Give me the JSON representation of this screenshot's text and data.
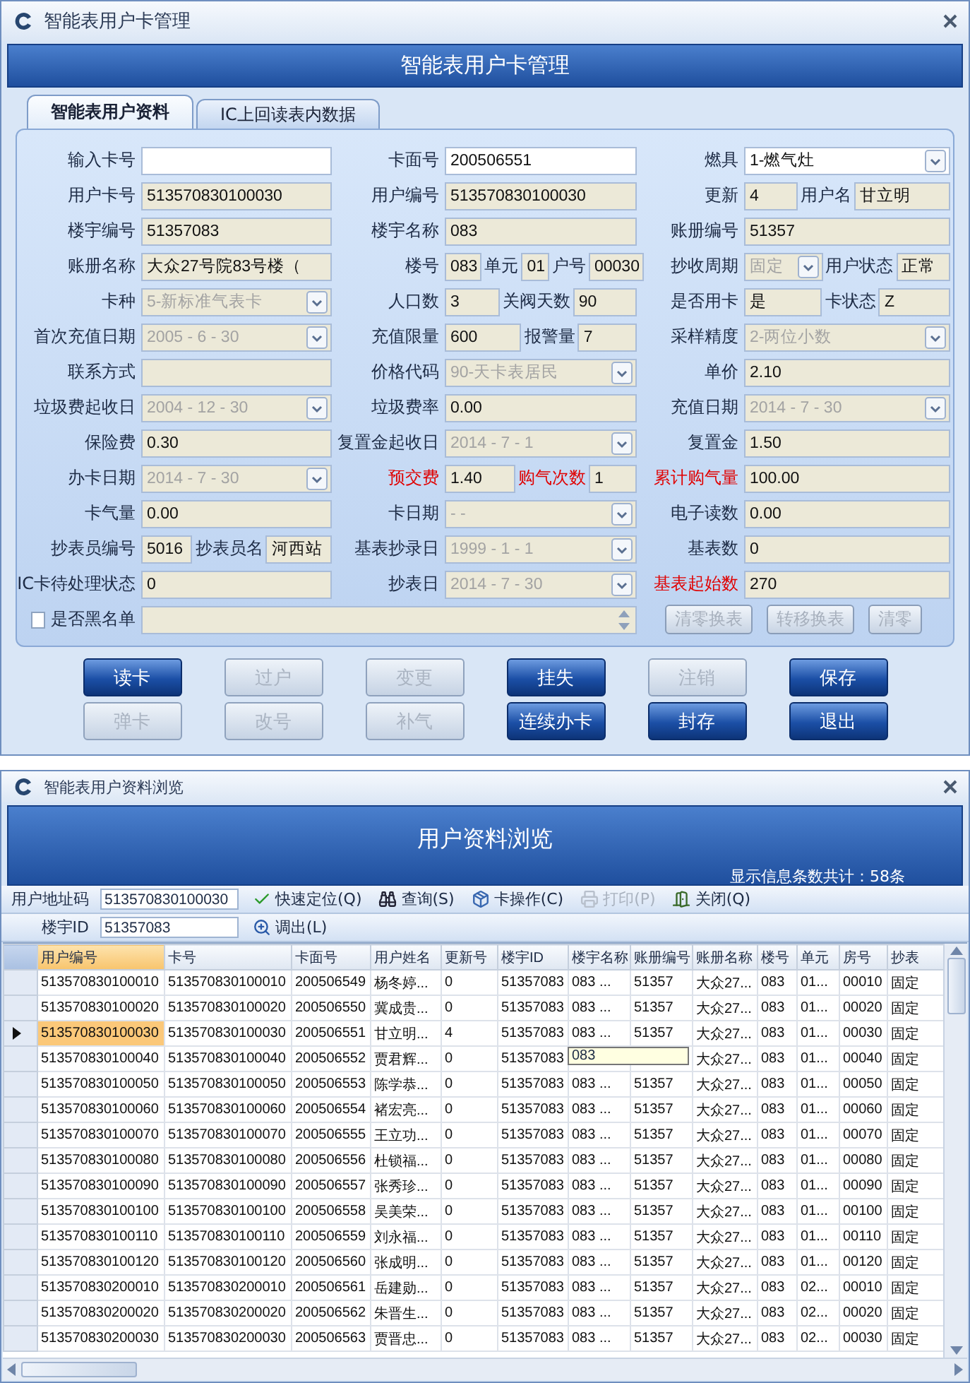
{
  "main_window": {
    "title": "智能表用户卡管理",
    "header": "智能表用户卡管理",
    "tabs": [
      {
        "label": "智能表用户资料",
        "selected": true
      },
      {
        "label": "IC上回读表内数据",
        "selected": false
      }
    ],
    "form_rows": [
      {
        "kind": "fields",
        "cells": [
          {
            "label": "输入卡号",
            "fields": [
              {
                "kind": "input"
              }
            ]
          },
          {
            "label": "卡面号",
            "fields": [
              {
                "kind": "input",
                "value": "200506551"
              }
            ]
          },
          {
            "label": "燃具",
            "fields": [
              {
                "kind": "select",
                "value": "1-燃气灶",
                "enabled": true
              }
            ]
          }
        ]
      },
      {
        "kind": "fields",
        "cells": [
          {
            "label": "用户卡号",
            "fields": [
              {
                "kind": "readonly",
                "value": "513570830100030"
              }
            ]
          },
          {
            "label": "用户编号",
            "fields": [
              {
                "kind": "readonly",
                "value": "513570830100030"
              }
            ]
          },
          {
            "label": "更新",
            "fields": [
              {
                "kind": "readonly",
                "value": "4"
              },
              {
                "kind": "caption",
                "text": "用户名"
              },
              {
                "kind": "readonly",
                "value": "甘立明"
              }
            ]
          }
        ]
      },
      {
        "kind": "fields",
        "cells": [
          {
            "label": "楼宇编号",
            "fields": [
              {
                "kind": "readonly",
                "value": "51357083"
              }
            ]
          },
          {
            "label": "楼宇名称",
            "fields": [
              {
                "kind": "readonly",
                "value": "083"
              }
            ]
          },
          {
            "label": "账册编号",
            "fields": [
              {
                "kind": "readonly",
                "value": "51357"
              }
            ]
          }
        ]
      },
      {
        "kind": "fields",
        "cells": [
          {
            "label": "账册名称",
            "fields": [
              {
                "kind": "readonly",
                "value": "大众27号院83号楼（"
              }
            ]
          },
          {
            "label": "楼号",
            "fields": [
              {
                "kind": "readonly",
                "value": "083"
              },
              {
                "kind": "caption",
                "text": "单元"
              },
              {
                "kind": "readonly",
                "value": "01"
              },
              {
                "kind": "caption",
                "text": "户号"
              },
              {
                "kind": "readonly",
                "value": "00030"
              }
            ]
          },
          {
            "label": "抄收周期",
            "fields": [
              {
                "kind": "select",
                "value": "固定",
                "enabled": false
              },
              {
                "kind": "caption",
                "text": "用户状态"
              },
              {
                "kind": "readonly",
                "value": "正常"
              }
            ]
          }
        ]
      },
      {
        "kind": "fields",
        "cells": [
          {
            "label": "卡种",
            "fields": [
              {
                "kind": "select",
                "value": "5-新标准气表卡",
                "enabled": false
              }
            ]
          },
          {
            "label": "人口数",
            "fields": [
              {
                "kind": "readonly",
                "value": "3"
              },
              {
                "kind": "caption",
                "text": "关阀天数"
              },
              {
                "kind": "readonly",
                "value": "90"
              }
            ]
          },
          {
            "label": "是否用卡",
            "fields": [
              {
                "kind": "readonly",
                "value": "是"
              },
              {
                "kind": "caption",
                "text": "卡状态"
              },
              {
                "kind": "readonly",
                "value": "Z"
              }
            ]
          }
        ]
      },
      {
        "kind": "fields",
        "cells": [
          {
            "label": "首次充值日期",
            "fields": [
              {
                "kind": "select",
                "value": "2005 - 6 - 30",
                "enabled": false
              }
            ]
          },
          {
            "label": "充值限量",
            "fields": [
              {
                "kind": "readonly",
                "value": "600"
              },
              {
                "kind": "caption",
                "text": "报警量"
              },
              {
                "kind": "readonly",
                "value": "7"
              }
            ]
          },
          {
            "label": "采样精度",
            "fields": [
              {
                "kind": "select",
                "value": "2-两位小数",
                "enabled": false
              }
            ]
          }
        ]
      },
      {
        "kind": "fields",
        "cells": [
          {
            "label": "联系方式",
            "fields": [
              {
                "kind": "readonly"
              }
            ]
          },
          {
            "label": "价格代码",
            "fields": [
              {
                "kind": "select",
                "value": "90-天卡表居民",
                "enabled": false
              }
            ]
          },
          {
            "label": "单价",
            "fields": [
              {
                "kind": "readonly",
                "value": "2.10"
              }
            ]
          }
        ]
      },
      {
        "kind": "fields",
        "cells": [
          {
            "label": "垃圾费起收日",
            "fields": [
              {
                "kind": "select",
                "value": "2004 - 12 - 30",
                "enabled": false
              }
            ]
          },
          {
            "label": "垃圾费率",
            "fields": [
              {
                "kind": "readonly",
                "value": "0.00"
              }
            ]
          },
          {
            "label": "充值日期",
            "fields": [
              {
                "kind": "select",
                "value": "2014 - 7 - 30",
                "enabled": false
              }
            ]
          }
        ]
      },
      {
        "kind": "fields",
        "cells": [
          {
            "label": "保险费",
            "fields": [
              {
                "kind": "readonly",
                "value": "0.30"
              }
            ]
          },
          {
            "label": "复置金起收日",
            "fields": [
              {
                "kind": "select",
                "value": "2014 - 7 - 1",
                "enabled": false
              }
            ]
          },
          {
            "label": "复置金",
            "fields": [
              {
                "kind": "readonly",
                "value": "1.50"
              }
            ]
          }
        ]
      },
      {
        "kind": "fields",
        "cells": [
          {
            "label": "办卡日期",
            "fields": [
              {
                "kind": "select",
                "value": "2014 - 7 - 30",
                "enabled": false
              }
            ]
          },
          {
            "label": "预交费",
            "alert": true,
            "fields": [
              {
                "kind": "readonly",
                "value": "1.40"
              },
              {
                "kind": "caption",
                "text": "购气次数",
                "alert": true
              },
              {
                "kind": "readonly",
                "value": "1"
              }
            ]
          },
          {
            "label": "累计购气量",
            "alert": true,
            "fields": [
              {
                "kind": "readonly",
                "value": "100.00"
              }
            ]
          }
        ]
      },
      {
        "kind": "fields",
        "cells": [
          {
            "label": "卡气量",
            "fields": [
              {
                "kind": "readonly",
                "value": "0.00"
              }
            ]
          },
          {
            "label": "卡日期",
            "fields": [
              {
                "kind": "select",
                "value": "-   -",
                "enabled": false
              }
            ]
          },
          {
            "label": "电子读数",
            "fields": [
              {
                "kind": "readonly",
                "value": "0.00"
              }
            ]
          }
        ]
      },
      {
        "kind": "fields",
        "cells": [
          {
            "label": "抄表员编号",
            "fields": [
              {
                "kind": "readonly",
                "value": "5016"
              },
              {
                "kind": "caption",
                "text": "抄表员名"
              },
              {
                "kind": "readonly",
                "value": "河西站"
              }
            ]
          },
          {
            "label": "基表抄录日",
            "fields": [
              {
                "kind": "select",
                "value": "1999 - 1 - 1",
                "enabled": false
              }
            ]
          },
          {
            "label": "基表数",
            "fields": [
              {
                "kind": "readonly",
                "value": "0"
              }
            ]
          }
        ]
      },
      {
        "kind": "fields",
        "cells": [
          {
            "label": "IC卡待处理状态",
            "fields": [
              {
                "kind": "readonly",
                "value": "0"
              }
            ]
          },
          {
            "label": "抄表日",
            "fields": [
              {
                "kind": "select",
                "value": "2014 - 7 - 30",
                "enabled": false
              }
            ]
          },
          {
            "label": "基表起始数",
            "alert": true,
            "fields": [
              {
                "kind": "readonly",
                "value": "270"
              }
            ]
          }
        ]
      },
      {
        "kind": "blacklist",
        "label": "是否黑名单",
        "checked": false,
        "actions": [
          {
            "label": "清零换表",
            "enabled": false
          },
          {
            "label": "转移换表",
            "enabled": false
          },
          {
            "label": "清零",
            "enabled": false
          }
        ]
      }
    ],
    "button_rows": [
      [
        {
          "label": "读卡",
          "enabled": true
        },
        {
          "label": "过户",
          "enabled": false
        },
        {
          "label": "变更",
          "enabled": false
        },
        {
          "label": "挂失",
          "enabled": true
        },
        {
          "label": "注销",
          "enabled": false
        },
        {
          "label": "保存",
          "enabled": true
        }
      ],
      [
        {
          "label": "弹卡",
          "enabled": false
        },
        {
          "label": "改号",
          "enabled": false
        },
        {
          "label": "补气",
          "enabled": false
        },
        {
          "label": "连续办卡",
          "enabled": true
        },
        {
          "label": "封存",
          "enabled": true
        },
        {
          "label": "退出",
          "enabled": true
        }
      ]
    ]
  },
  "browse_window": {
    "title": "智能表用户资料浏览",
    "header": "用户资料浏览",
    "count": "显示信息条数共计：58条",
    "toolbars": [
      [
        {
          "kind": "label",
          "text": "用户地址码"
        },
        {
          "kind": "input",
          "value": "513570830100030"
        },
        {
          "kind": "button",
          "label": "快速定位(Q)",
          "enabled": true
        },
        {
          "kind": "button",
          "label": "查询(S)",
          "enabled": true
        },
        {
          "kind": "button",
          "label": "卡操作(C)",
          "enabled": true
        },
        {
          "kind": "button",
          "label": "打印(P)",
          "enabled": false
        },
        {
          "kind": "button",
          "label": "关闭(Q)",
          "enabled": true
        }
      ],
      [
        {
          "kind": "label",
          "text": "楼宇ID"
        },
        {
          "kind": "input",
          "value": "51357083"
        },
        {
          "kind": "button",
          "label": "调出(L)",
          "enabled": true
        }
      ]
    ],
    "table": {
      "columns": [
        {
          "label": "用户编号",
          "selected": true
        },
        {
          "label": "卡号",
          "selected": false
        },
        {
          "label": "卡面号",
          "selected": false
        },
        {
          "label": "用户姓名",
          "selected": false
        },
        {
          "label": "更新号",
          "selected": false
        },
        {
          "label": "楼宇ID",
          "selected": false
        },
        {
          "label": "楼宇名称",
          "selected": false
        },
        {
          "label": "账册编号",
          "selected": false
        },
        {
          "label": "账册名称",
          "selected": false
        },
        {
          "label": "楼号",
          "selected": false
        },
        {
          "label": "单元",
          "selected": false
        },
        {
          "label": "房号",
          "selected": false
        },
        {
          "label": "抄表",
          "selected": false
        }
      ],
      "rows": [
        {
          "selected": false,
          "cells": [
            "513570830100010",
            "513570830100010",
            "200506549",
            "杨冬婷...",
            "0",
            "51357083",
            "083 ...",
            "51357",
            "大众27...",
            "083",
            "01...",
            "00010",
            "固定"
          ]
        },
        {
          "selected": false,
          "cells": [
            "513570830100020",
            "513570830100020",
            "200506550",
            "冀成贵...",
            "0",
            "51357083",
            "083 ...",
            "51357",
            "大众27...",
            "083",
            "01...",
            "00020",
            "固定"
          ]
        },
        {
          "selected": true,
          "cells": [
            "513570830100030",
            "513570830100030",
            "200506551",
            "甘立明...",
            "4",
            "51357083",
            "083 ...",
            "51357",
            "大众27...",
            "083",
            "01...",
            "00030",
            "固定"
          ]
        },
        {
          "selected": false,
          "cells": [
            "513570830100040",
            "513570830100040",
            "200506552",
            "贾君辉...",
            "0",
            "51357083",
            null,
            null,
            "大众27...",
            "083",
            "01...",
            "00040",
            "固定"
          ]
        },
        {
          "selected": false,
          "cells": [
            "513570830100050",
            "513570830100050",
            "200506553",
            "陈学恭...",
            "0",
            "51357083",
            "083 ...",
            "51357",
            "大众27...",
            "083",
            "01...",
            "00050",
            "固定"
          ]
        },
        {
          "selected": false,
          "cells": [
            "513570830100060",
            "513570830100060",
            "200506554",
            "褚宏亮...",
            "0",
            "51357083",
            "083 ...",
            "51357",
            "大众27...",
            "083",
            "01...",
            "00060",
            "固定"
          ]
        },
        {
          "selected": false,
          "cells": [
            "513570830100070",
            "513570830100070",
            "200506555",
            "王立功...",
            "0",
            "51357083",
            "083 ...",
            "51357",
            "大众27...",
            "083",
            "01...",
            "00070",
            "固定"
          ]
        },
        {
          "selected": false,
          "cells": [
            "513570830100080",
            "513570830100080",
            "200506556",
            "杜锁福...",
            "0",
            "51357083",
            "083 ...",
            "51357",
            "大众27...",
            "083",
            "01...",
            "00080",
            "固定"
          ]
        },
        {
          "selected": false,
          "cells": [
            "513570830100090",
            "513570830100090",
            "200506557",
            "张秀珍...",
            "0",
            "51357083",
            "083 ...",
            "51357",
            "大众27...",
            "083",
            "01...",
            "00090",
            "固定"
          ]
        },
        {
          "selected": false,
          "cells": [
            "513570830100100",
            "513570830100100",
            "200506558",
            "吴美荣...",
            "0",
            "51357083",
            "083 ...",
            "51357",
            "大众27...",
            "083",
            "01...",
            "00100",
            "固定"
          ]
        },
        {
          "selected": false,
          "cells": [
            "513570830100110",
            "513570830100110",
            "200506559",
            "刘永福...",
            "0",
            "51357083",
            "083 ...",
            "51357",
            "大众27...",
            "083",
            "01...",
            "00110",
            "固定"
          ]
        },
        {
          "selected": false,
          "cells": [
            "513570830100120",
            "513570830100120",
            "200506560",
            "张成明...",
            "0",
            "51357083",
            "083 ...",
            "51357",
            "大众27...",
            "083",
            "01...",
            "00120",
            "固定"
          ]
        },
        {
          "selected": false,
          "cells": [
            "513570830200010",
            "513570830200010",
            "200506561",
            "岳建勋...",
            "0",
            "51357083",
            "083 ...",
            "51357",
            "大众27...",
            "083",
            "02...",
            "00010",
            "固定"
          ]
        },
        {
          "selected": false,
          "cells": [
            "513570830200020",
            "513570830200020",
            "200506562",
            "朱晋生...",
            "0",
            "51357083",
            "083 ...",
            "51357",
            "大众27...",
            "083",
            "02...",
            "00020",
            "固定"
          ]
        },
        {
          "selected": false,
          "cells": [
            "513570830200030",
            "513570830200030",
            "200506563",
            "贾晋忠...",
            "0",
            "51357083",
            "083 ...",
            "51357",
            "大众27...",
            "083",
            "02...",
            "00030",
            "固定"
          ]
        }
      ],
      "tooltip": "083"
    }
  }
}
